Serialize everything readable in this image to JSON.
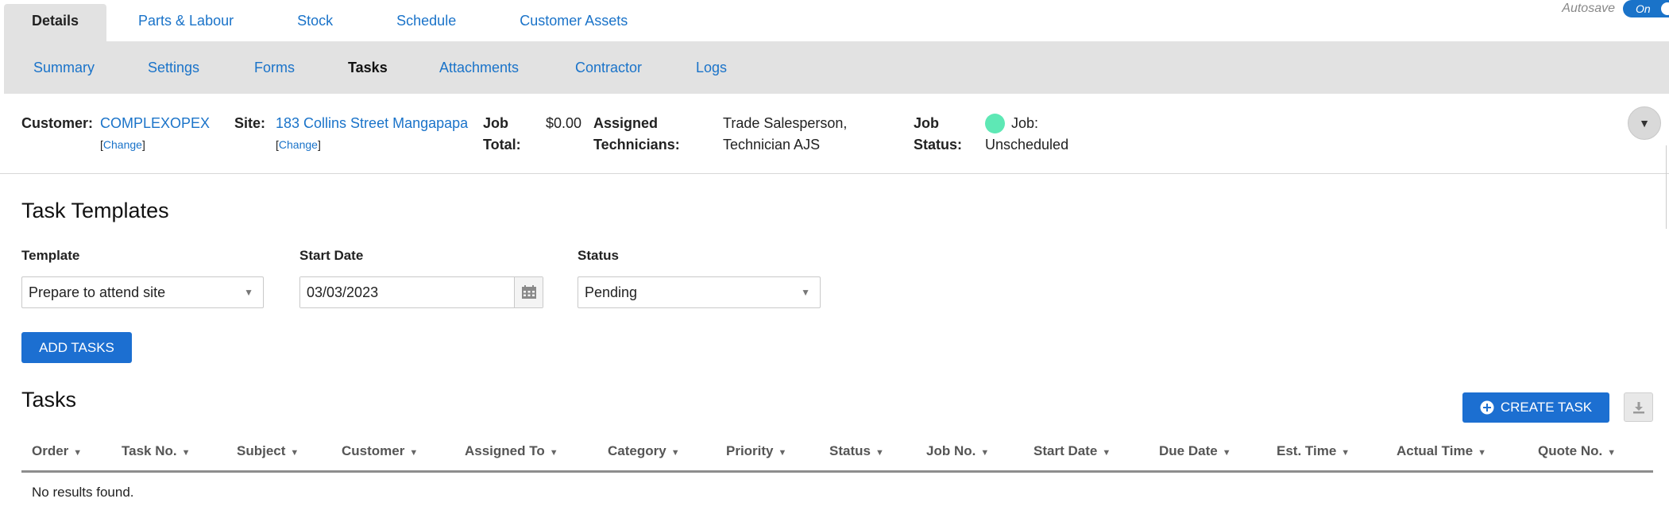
{
  "top_tabs": [
    {
      "label": "Details",
      "active": true
    },
    {
      "label": "Parts & Labour"
    },
    {
      "label": "Stock"
    },
    {
      "label": "Schedule"
    },
    {
      "label": "Customer Assets"
    }
  ],
  "autosave": {
    "label": "Autosave",
    "toggle": "On"
  },
  "sub_tabs": [
    {
      "label": "Summary"
    },
    {
      "label": "Settings"
    },
    {
      "label": "Forms"
    },
    {
      "label": "Tasks",
      "active": true
    },
    {
      "label": "Attachments"
    },
    {
      "label": "Contractor"
    },
    {
      "label": "Logs"
    }
  ],
  "info": {
    "customer_label": "Customer:",
    "customer_value": "COMPLEXOPEX",
    "change_link": "Change",
    "site_label": "Site:",
    "site_value": "183 Collins Street Mangapapa",
    "job_total_label_1": "Job",
    "job_total_label_2": "Total:",
    "job_total_value": "$0.00",
    "assigned_label_1": "Assigned",
    "assigned_label_2": "Technicians:",
    "assigned_value_1": "Trade Salesperson,",
    "assigned_value_2": "Technician AJS",
    "job_status_label_1": "Job",
    "job_status_label_2": "Status:",
    "job_status_value_1": "Job:",
    "job_status_value_2": "Unscheduled",
    "status_color": "#5ee8b5"
  },
  "templates": {
    "heading": "Task Templates",
    "template_label": "Template",
    "template_value": "Prepare to attend site",
    "start_date_label": "Start Date",
    "start_date_value": "03/03/2023",
    "status_label": "Status",
    "status_value": "Pending",
    "add_button": "ADD TASKS"
  },
  "tasks": {
    "heading": "Tasks",
    "create_button": "CREATE TASK",
    "columns": [
      "Order",
      "Task No.",
      "Subject",
      "Customer",
      "Assigned To",
      "Category",
      "Priority",
      "Status",
      "Job No.",
      "Start Date",
      "Due Date",
      "Est. Time",
      "Actual Time",
      "Quote No."
    ],
    "empty_text": "No results found."
  },
  "colors": {
    "accent": "#1c6fd1",
    "link": "#1a73c9",
    "subnav_bg": "#e2e2e2"
  }
}
